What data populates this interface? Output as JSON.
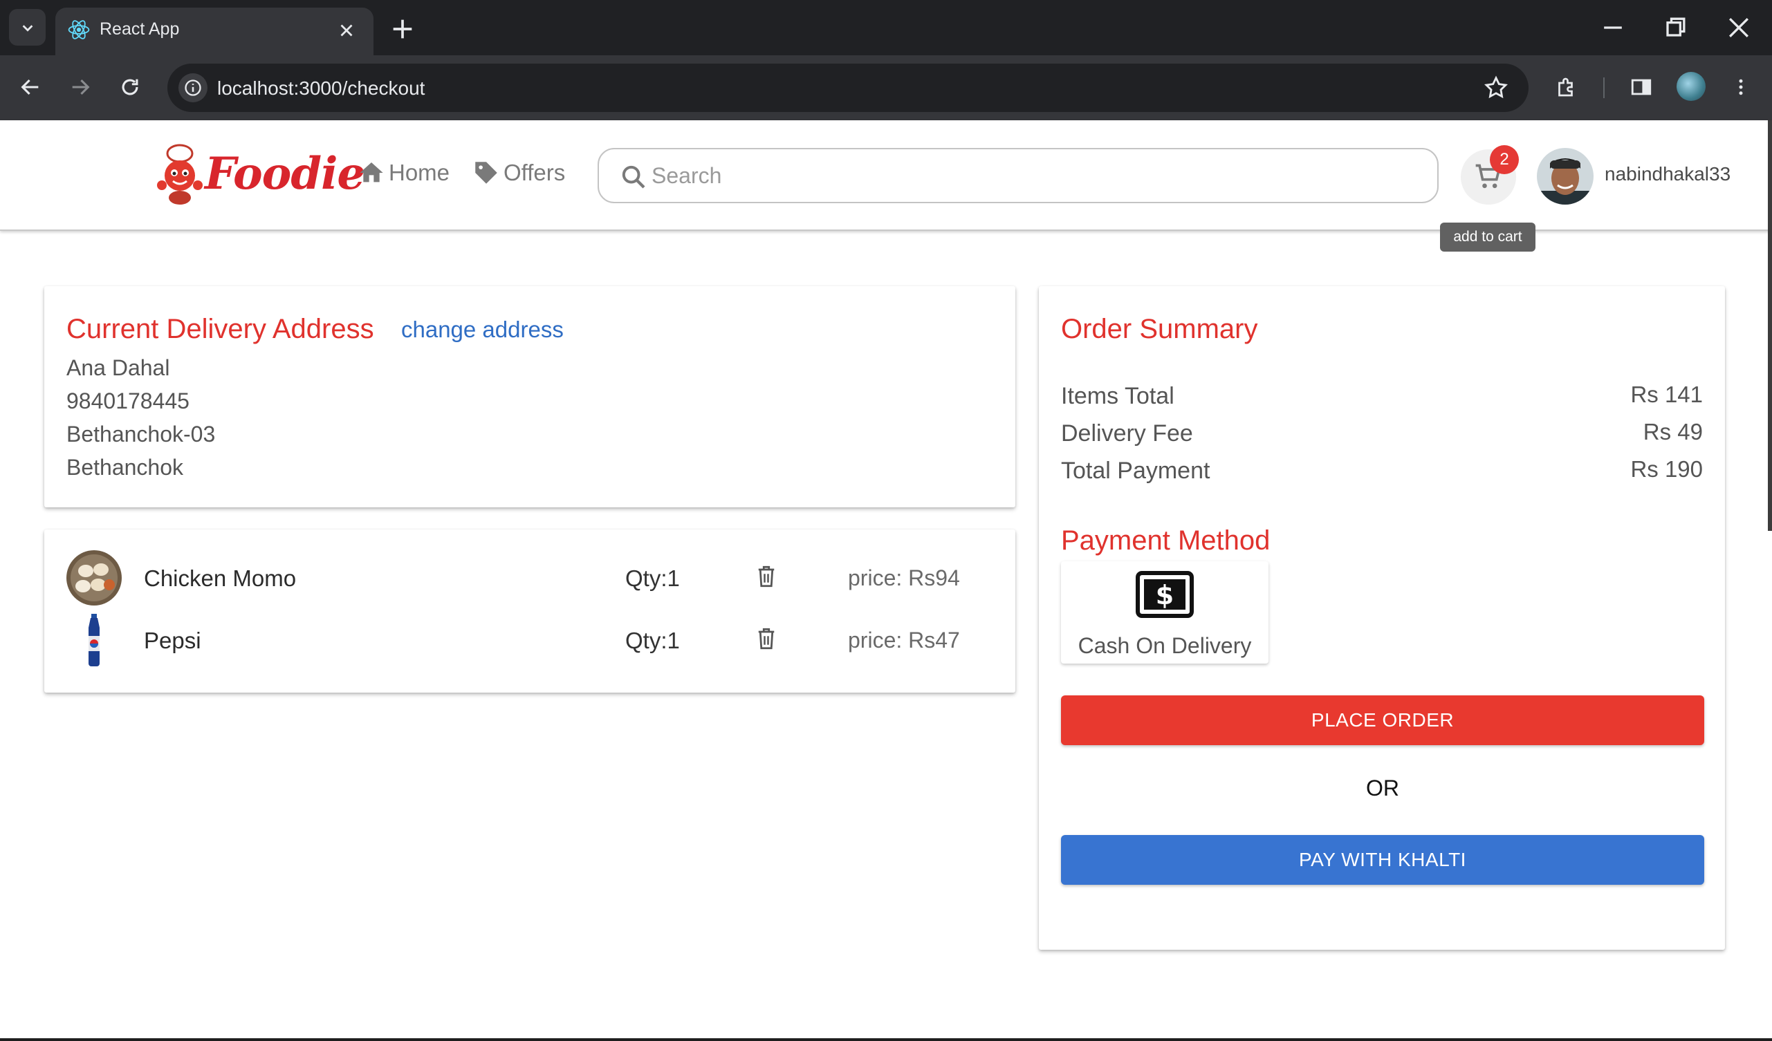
{
  "browser": {
    "tab_title": "React App",
    "url": "localhost:3000/checkout"
  },
  "header": {
    "logo_text": "Foodie",
    "nav": [
      {
        "label": "Home",
        "icon": "home-icon"
      },
      {
        "label": "Offers",
        "icon": "tag-icon"
      }
    ],
    "search_placeholder": "Search",
    "cart_count": "2",
    "cart_tooltip": "add to cart",
    "username": "nabindhakal33"
  },
  "address": {
    "heading": "Current Delivery Address",
    "change_label": "change address",
    "lines": [
      "Ana Dahal",
      "9840178445",
      "Bethanchok-03",
      "Bethanchok"
    ]
  },
  "items": [
    {
      "name": "Chicken Momo",
      "qty": "Qty:1",
      "price": "price: Rs94",
      "thumb": "momo"
    },
    {
      "name": "Pepsi",
      "qty": "Qty:1",
      "price": "price: Rs47",
      "thumb": "pepsi-bottle"
    }
  ],
  "summary": {
    "heading": "Order Summary",
    "rows": [
      {
        "label": "Items Total",
        "value": "Rs 141"
      },
      {
        "label": "Delivery Fee",
        "value": "Rs 49"
      },
      {
        "label": "Total Payment",
        "value": "Rs 190"
      }
    ],
    "payment_heading": "Payment Method",
    "payment_option": "Cash On Delivery",
    "place_order": "PLACE ORDER",
    "or": "OR",
    "khalti": "PAY WITH KHALTI"
  },
  "colors": {
    "accent_red": "#e0322d",
    "button_red": "#e8392f",
    "button_blue": "#3874d1",
    "link_blue": "#2f6dc4",
    "badge_red": "#e53935"
  }
}
